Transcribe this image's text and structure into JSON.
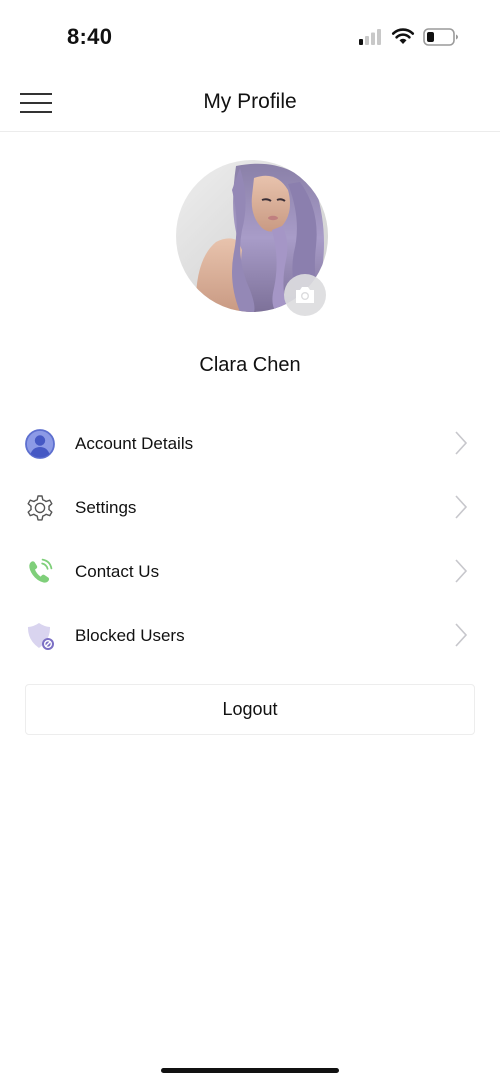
{
  "status_bar": {
    "time": "8:40"
  },
  "nav": {
    "title": "My Profile"
  },
  "profile": {
    "name": "Clara Chen"
  },
  "menu": {
    "items": [
      {
        "label": "Account Details",
        "icon": "account-icon"
      },
      {
        "label": "Settings",
        "icon": "gear-icon"
      },
      {
        "label": "Contact Us",
        "icon": "phone-icon"
      },
      {
        "label": "Blocked Users",
        "icon": "blocked-shield-icon"
      }
    ]
  },
  "logout_label": "Logout",
  "colors": {
    "account_icon": "#6b7fd7",
    "contact_icon": "#7fcf7a",
    "blocked_icon": "#b9b2df",
    "chevron": "#c7c7cc"
  }
}
